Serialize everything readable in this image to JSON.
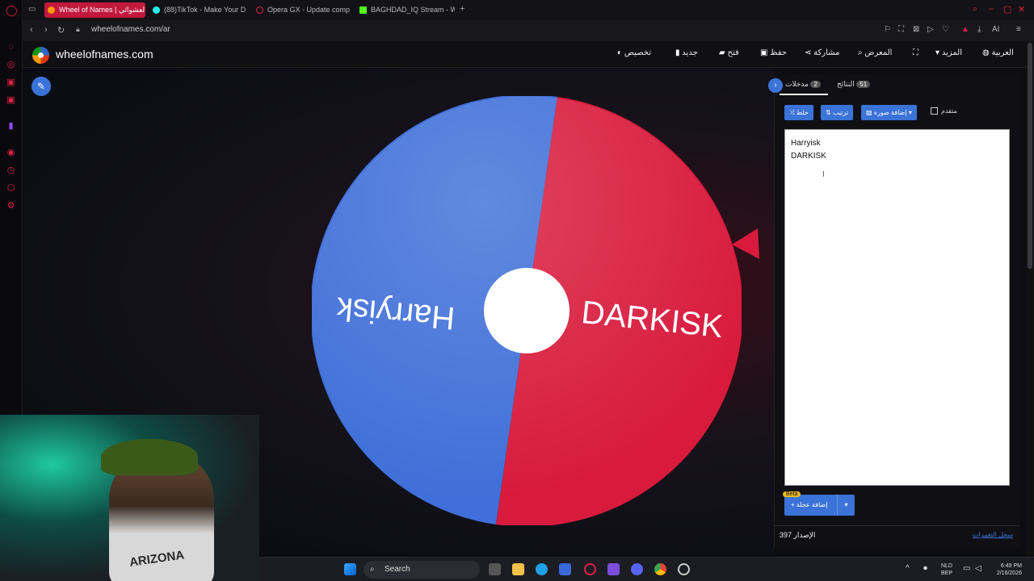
{
  "browser": {
    "tabs": [
      {
        "label": "Wheel of Names | العشوائي",
        "active": true,
        "color": "#c2183d"
      },
      {
        "label": "(88)TikTok - Make Your D",
        "active": false,
        "color": "#25f4ee"
      },
      {
        "label": "Opera GX - Update comp",
        "active": false,
        "color": "#e0204a"
      },
      {
        "label": "BAGHDAD_IQ Stream - W",
        "active": false,
        "color": "#53fc18"
      }
    ],
    "url": "wheelofnames.com/ar",
    "ai_label": "AI"
  },
  "site": {
    "title": "wheelofnames.com",
    "menu": [
      {
        "label": "تخصيص",
        "icon": "palette-icon"
      },
      {
        "label": "جديد",
        "icon": "file-icon"
      },
      {
        "label": "فتح",
        "icon": "folder-icon"
      },
      {
        "label": "حفظ",
        "icon": "save-icon"
      },
      {
        "label": "مشاركة",
        "icon": "share-icon"
      },
      {
        "label": "المعرض",
        "icon": "search-icon"
      },
      {
        "label": "",
        "icon": "fullscreen-icon"
      },
      {
        "label": "المزيد",
        "icon": "caret-down-icon"
      },
      {
        "label": "العربية",
        "icon": "globe-icon"
      }
    ]
  },
  "wheel": {
    "segments": [
      {
        "label": "Harryisk",
        "color": "#3f6fd8"
      },
      {
        "label": "DARKISK",
        "color": "#d81a3c"
      }
    ]
  },
  "panel": {
    "tabs": [
      {
        "label": "مدخلات",
        "count": "2"
      },
      {
        "label": "النتائج",
        "count": "51"
      }
    ],
    "toolbar": {
      "shuffle": "خلط",
      "sort": "ترتيب",
      "add_image": "إضافة صورة",
      "advanced": "متقدم"
    },
    "entries": [
      "Harryisk",
      "DARKISK"
    ],
    "add_wheel": "إضافة عجلة",
    "beta": "Beta",
    "version_label": "الإصدار",
    "version_number": "397",
    "changelog": "سجل التغييرات"
  },
  "taskbar": {
    "search_placeholder": "Search",
    "lang_top": "NLD",
    "lang_bottom": "BEP",
    "time": "6:49 PM",
    "date": "2/16/2026"
  },
  "webcam": {
    "shirt_text": "ARIZONA"
  }
}
